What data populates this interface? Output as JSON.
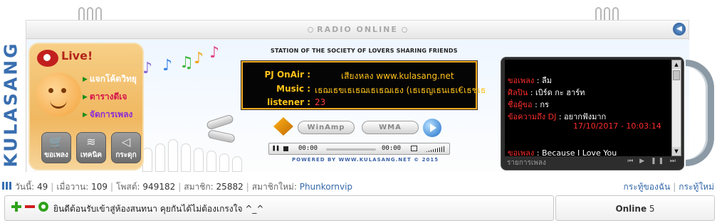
{
  "brand": "KULASANG",
  "radio": {
    "title": "RADIO ONLINE",
    "slogan": "STATION OF THE SOCIETY OF LOVERS SHARING FRIENDS",
    "powered_by": "POWERED BY WWW.KULASANG.NET © 2015"
  },
  "live": {
    "title": "Live!",
    "menu": [
      "แจกโค้ดวิทยุ",
      "ตารางดีเจ",
      "จัดการเพลง"
    ],
    "buttons": [
      "ขอเพลง",
      "เทคนิค",
      "กระดุก"
    ]
  },
  "onair": {
    "dj_label": "PJ OnAir :",
    "dj_value": "เสียงหลง www.kulasang.net",
    "music_label": "Music :",
    "music_value": "เธฌเธขเธเธฌเธเธฌเธง (เธเธญเธนเธเ€เธชเธ",
    "listener_label": "listener :",
    "listener_value": "23"
  },
  "player": {
    "winamp_label": "WinAmp",
    "wma_label": "WMA",
    "time_current": "00:00",
    "time_total": "00:00"
  },
  "playlist": {
    "song_label": "ขอเพลง",
    "song_value": "ลืม",
    "artist_label": "ศิลปิน",
    "artist_value": "เบิร์ด กะ ฮาร์ท",
    "requester_label": "ชื่อผู้ขอ",
    "requester_value": "กร",
    "message_label": "ข้อความถึง DJ",
    "message_value": "อยากฟังมาก",
    "timestamp": "17/10/2017 - 10:03:14",
    "next_label": "ขอเพลง",
    "next_value": "Because I Love You",
    "footer": "รายการเพลง"
  },
  "stats": {
    "today_label": "วันนี้:",
    "today": "49",
    "yesterday_label": "เมื่อวาน:",
    "yesterday": "109",
    "posts_label": "โพสต์:",
    "posts": "949182",
    "members_label": "สมาชิก:",
    "members": "25882",
    "new_member_label": "สมาชิกใหม่:",
    "new_member": "Phunkornvip",
    "my_threads": "กระทู้ของฉัน",
    "new_threads": "กระทู้ใหม่"
  },
  "chat": {
    "message": "ยินดีต้อนรับเข้าสู่ห้องสนทนา คุยกันได้ไม่ต้องเกรงใจ ^_^",
    "online_label": "Online",
    "online_count": "5"
  }
}
